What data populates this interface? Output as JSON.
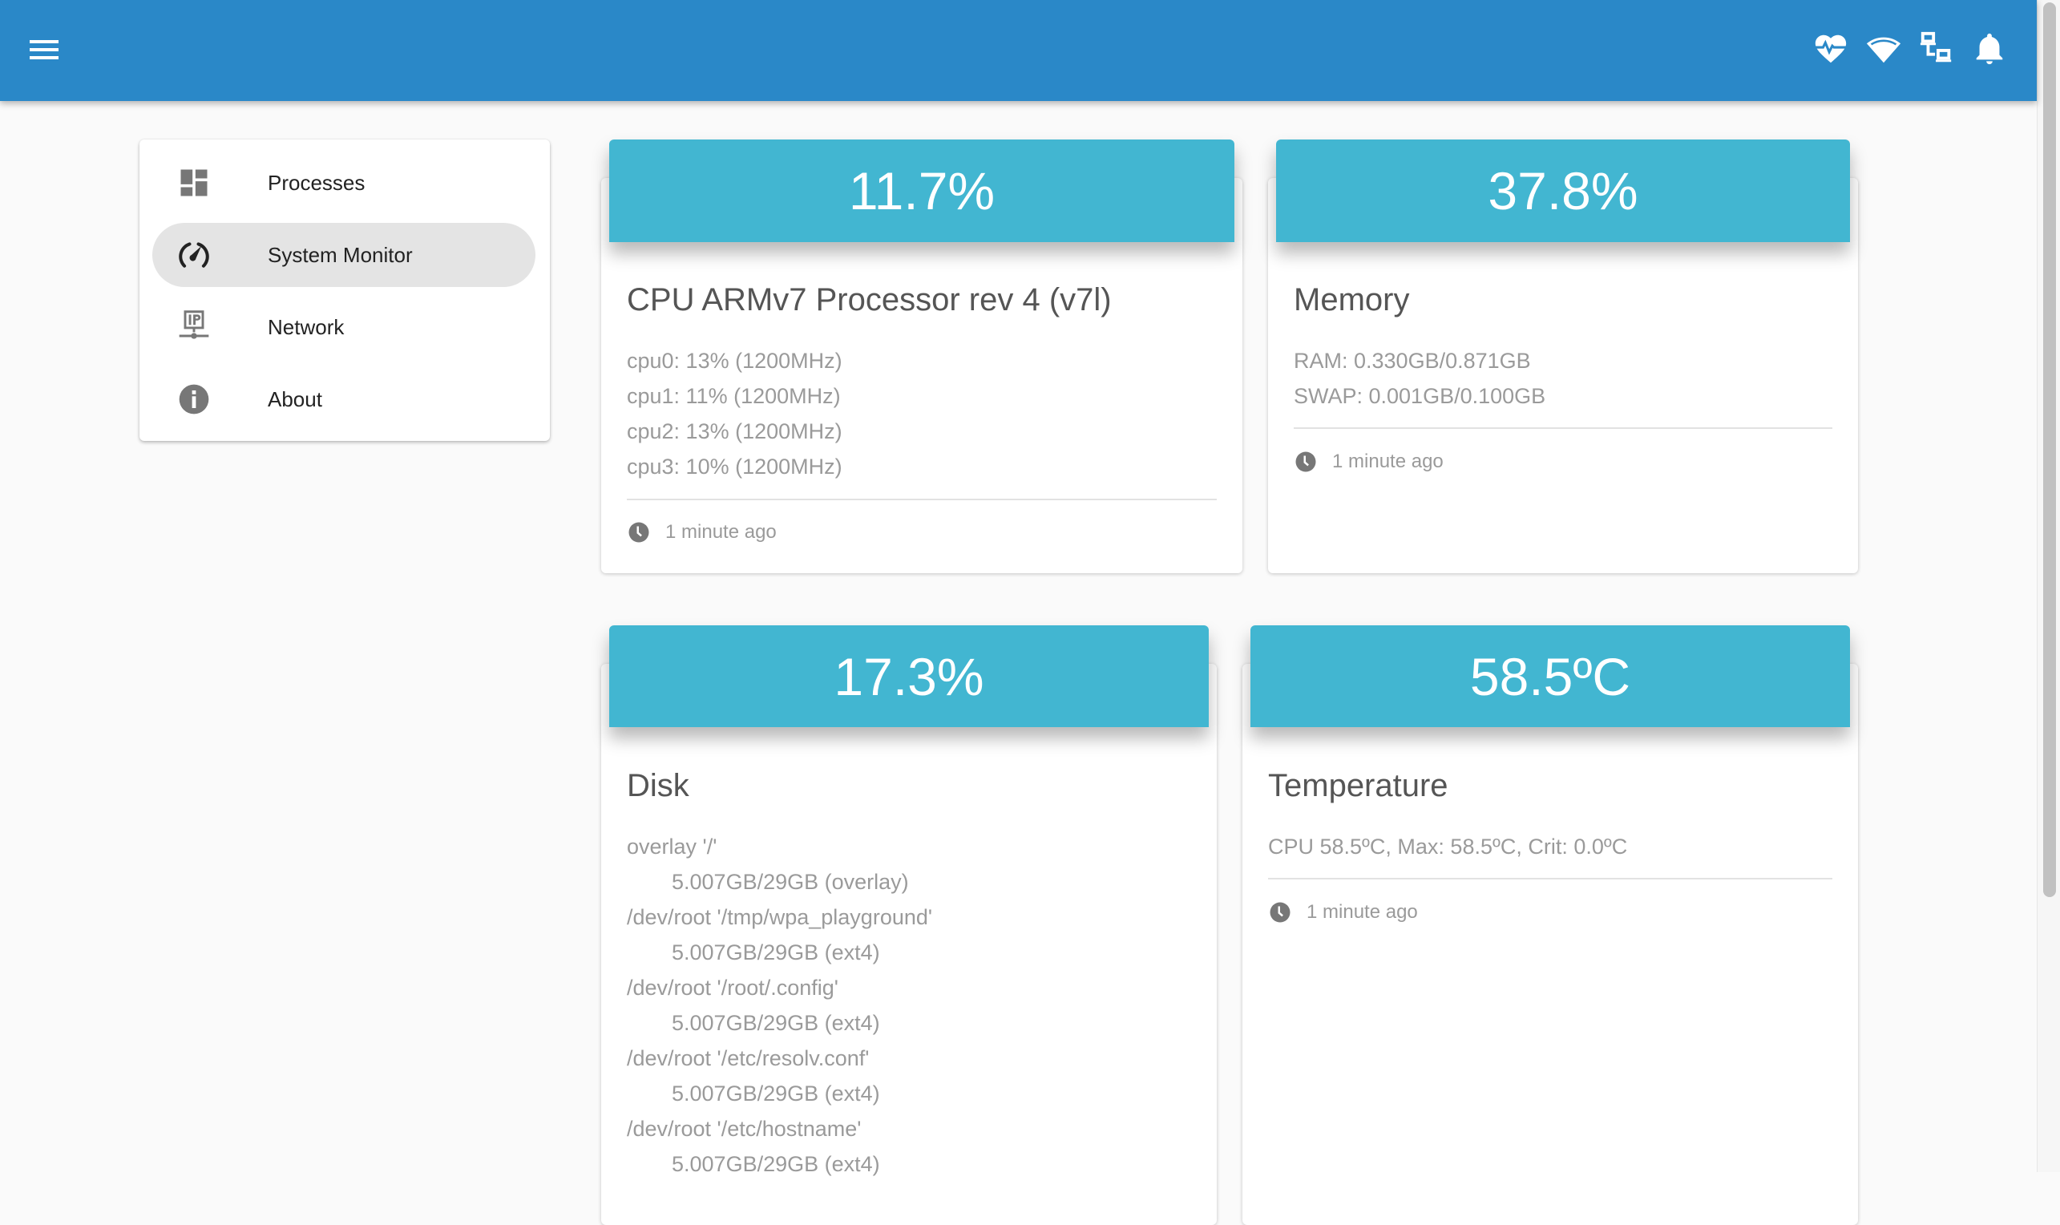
{
  "appbar": {
    "menu_icon": "hamburger-menu-icon",
    "status_icons": [
      "heart-pulse-icon",
      "wifi-icon",
      "network-lan-icon",
      "bell-icon"
    ],
    "color": "#2a88c8"
  },
  "sidebar": {
    "items": [
      {
        "label": "Processes",
        "icon": "dashboard-icon",
        "active": false
      },
      {
        "label": "System Monitor",
        "icon": "speedometer-icon",
        "active": true
      },
      {
        "label": "Network",
        "icon": "ip-network-icon",
        "active": false
      },
      {
        "label": "About",
        "icon": "info-icon",
        "active": false
      }
    ]
  },
  "cards": {
    "cpu": {
      "value": "11.7%",
      "title": "CPU ARMv7 Processor rev 4 (v7l)",
      "lines": [
        "cpu0: 13% (1200MHz)",
        "cpu1: 11% (1200MHz)",
        "cpu2: 13% (1200MHz)",
        "cpu3: 10% (1200MHz)"
      ],
      "updated": "1 minute ago"
    },
    "memory": {
      "value": "37.8%",
      "title": "Memory",
      "lines": [
        "RAM: 0.330GB/0.871GB",
        "SWAP: 0.001GB/0.100GB"
      ],
      "updated": "1 minute ago"
    },
    "disk": {
      "value": "17.3%",
      "title": "Disk",
      "lines": [
        "overlay '/'",
        "5.007GB/29GB (overlay)",
        "/dev/root '/tmp/wpa_playground'",
        "5.007GB/29GB (ext4)",
        "/dev/root '/root/.config'",
        "5.007GB/29GB (ext4)",
        "/dev/root '/etc/resolv.conf'",
        "5.007GB/29GB (ext4)",
        "/dev/root '/etc/hostname'",
        "5.007GB/29GB (ext4)"
      ]
    },
    "temperature": {
      "value": "58.5ºC",
      "title": "Temperature",
      "lines": [
        "CPU 58.5ºC, Max: 58.5ºC, Crit: 0.0ºC"
      ],
      "updated": "1 minute ago"
    }
  },
  "colors": {
    "card_header": "#42b6d1",
    "active_nav": "#e4e4e4"
  }
}
